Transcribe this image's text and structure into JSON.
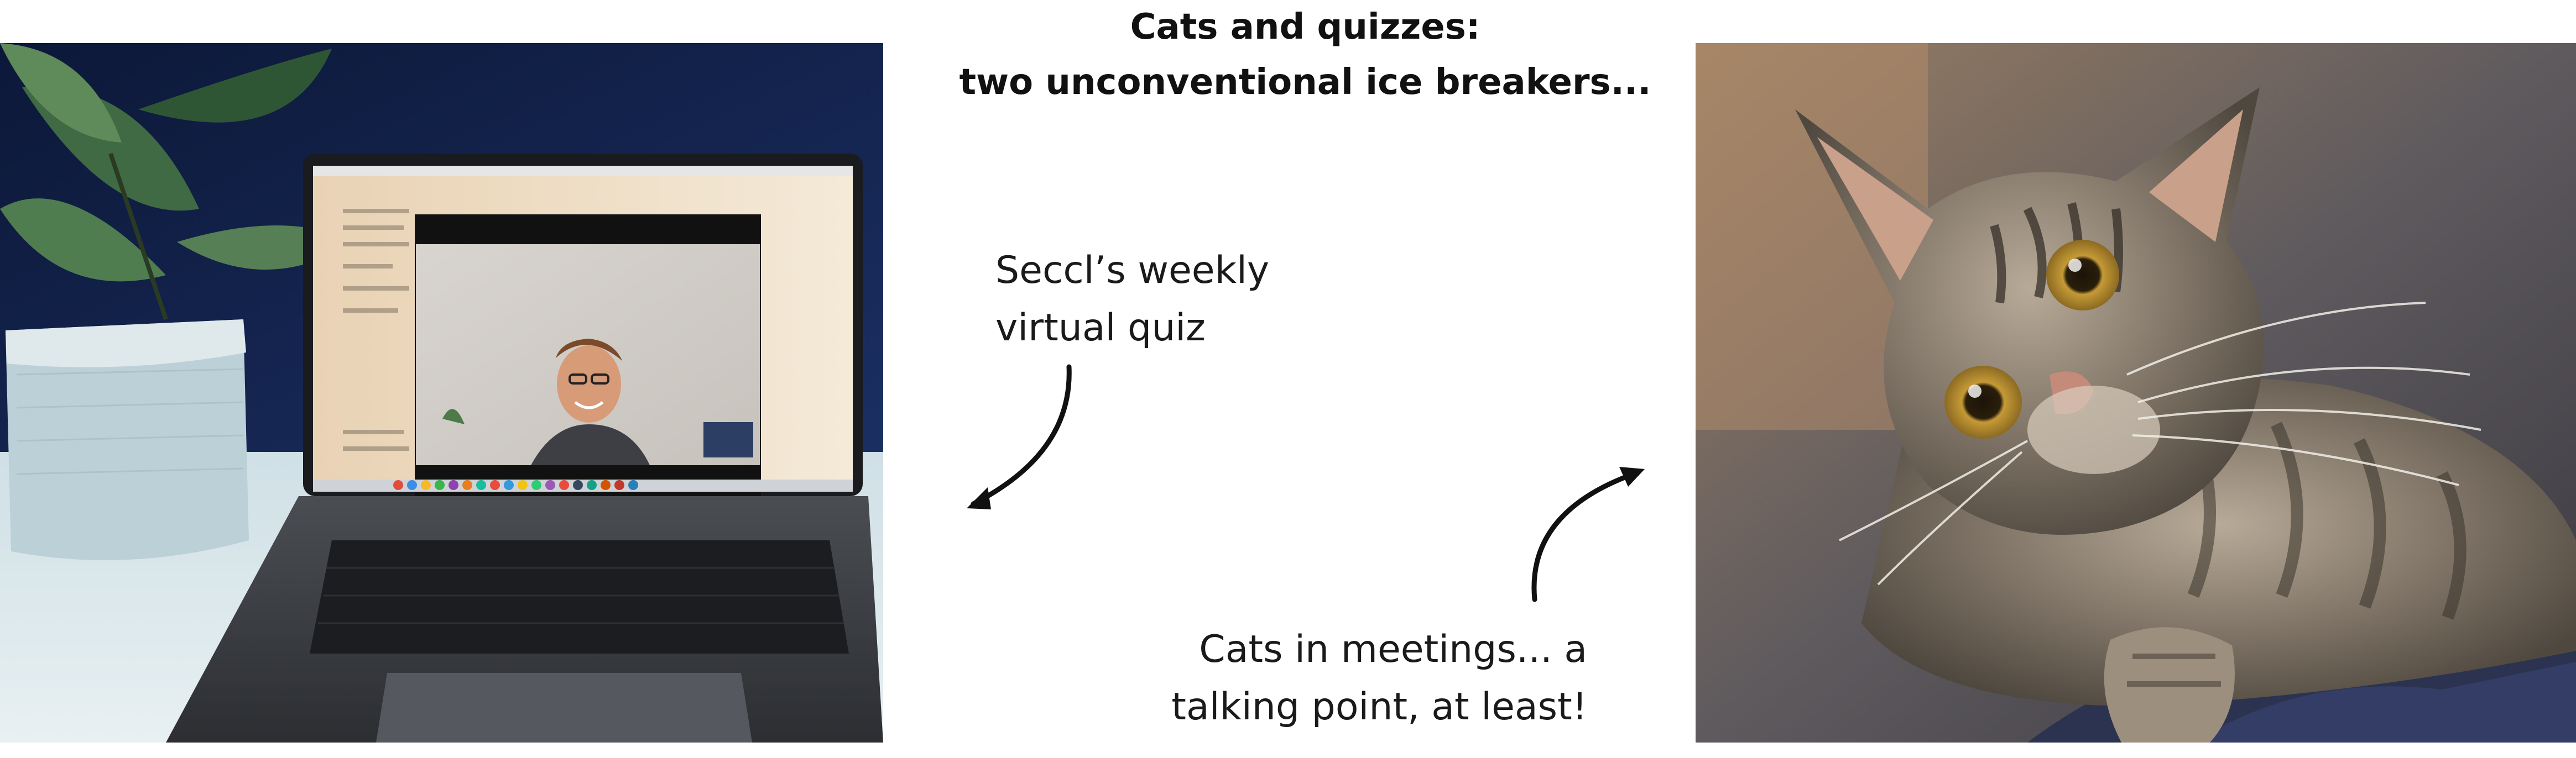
{
  "title": {
    "line1": "Cats and quizzes:",
    "line2": "two unconventional ice breakers..."
  },
  "captions": {
    "quiz": [
      "Seccl’s weekly",
      "virtual quiz"
    ],
    "cats": [
      "Cats in meetings... a",
      "talking point, at least!"
    ]
  },
  "images": {
    "left": "laptop-video-call-photo",
    "right": "tabby-cat-photo"
  },
  "colors": {
    "text": "#111111",
    "arrow": "#111111",
    "cat_fur": "#6e645a",
    "wall_blue": "#10214a",
    "laptop_gray": "#3a3c40"
  }
}
